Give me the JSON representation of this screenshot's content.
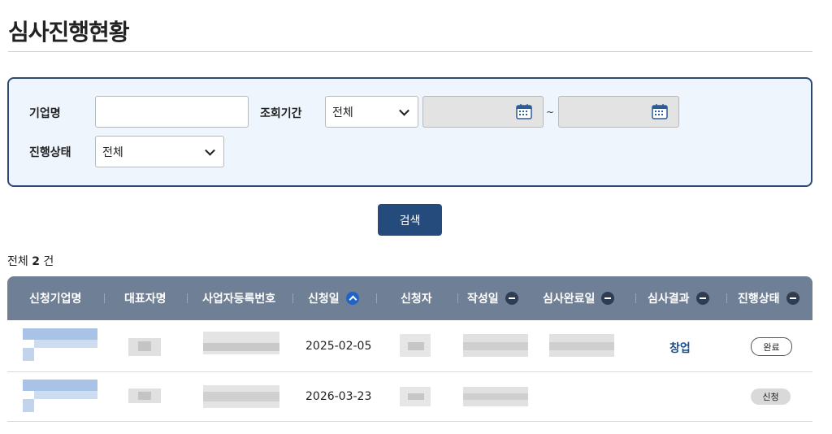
{
  "page": {
    "title": "심사진행현황"
  },
  "search": {
    "company_label": "기업명",
    "company_value": "",
    "period_label": "조회기간",
    "period_selected": "전체",
    "date_from": "",
    "date_to": "",
    "tilde": "~",
    "status_label": "진행상태",
    "status_selected": "전체",
    "search_button": "검색"
  },
  "summary": {
    "prefix": "전체",
    "count": "2",
    "suffix": "건"
  },
  "table": {
    "headers": [
      {
        "label": "신청기업명",
        "sort": ""
      },
      {
        "label": "대표자명",
        "sort": ""
      },
      {
        "label": "사업자등록번호",
        "sort": ""
      },
      {
        "label": "신청일",
        "sort": "asc"
      },
      {
        "label": "신청자",
        "sort": ""
      },
      {
        "label": "작성일",
        "sort": "none"
      },
      {
        "label": "심사완료일",
        "sort": "none"
      },
      {
        "label": "심사결과",
        "sort": "none"
      },
      {
        "label": "진행상태",
        "sort": "none"
      }
    ],
    "rows": [
      {
        "apply_date": "2025-02-05",
        "result": "창업",
        "status": "완료"
      },
      {
        "apply_date": "2026-03-23",
        "result": "",
        "status": "신청"
      }
    ]
  },
  "colors": {
    "panel_border": "#2b4a73",
    "panel_bg": "#eef5fd",
    "button": "#244b7c",
    "header_bg": "#6f7f95",
    "link": "#1a4f8f"
  }
}
